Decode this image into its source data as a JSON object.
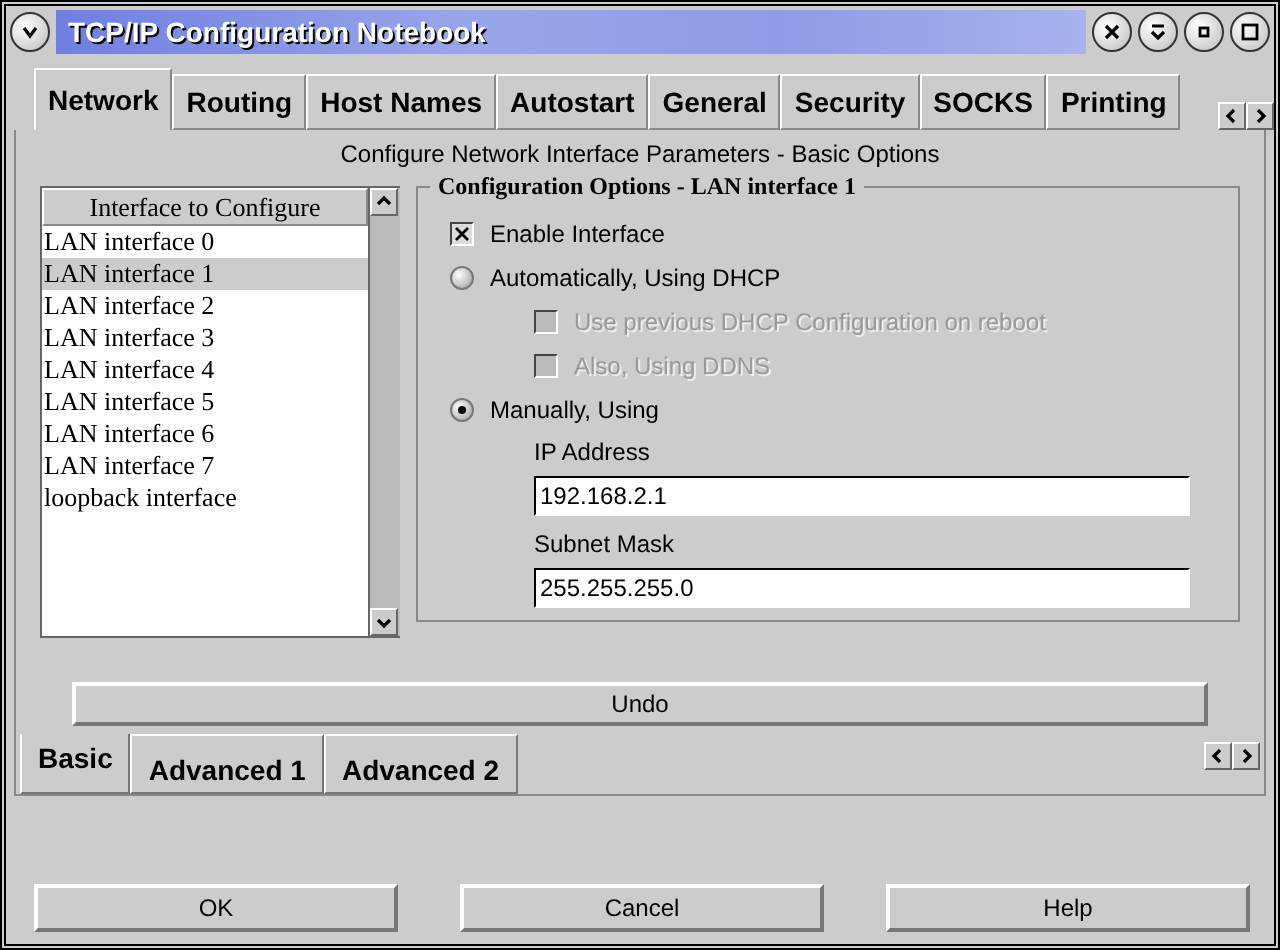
{
  "window": {
    "title": "TCP/IP Configuration Notebook"
  },
  "tabs": [
    {
      "label": "Network",
      "selected": true
    },
    {
      "label": "Routing",
      "selected": false
    },
    {
      "label": "Host Names",
      "selected": false
    },
    {
      "label": "Autostart",
      "selected": false
    },
    {
      "label": "General",
      "selected": false
    },
    {
      "label": "Security",
      "selected": false
    },
    {
      "label": "SOCKS",
      "selected": false
    },
    {
      "label": "Printing",
      "selected": false
    }
  ],
  "page_heading": "Configure Network Interface Parameters - Basic Options",
  "interface_list": {
    "header": "Interface to Configure",
    "items": [
      {
        "label": "LAN interface 0",
        "selected": false
      },
      {
        "label": "LAN interface 1",
        "selected": true
      },
      {
        "label": "LAN interface 2",
        "selected": false
      },
      {
        "label": "LAN interface 3",
        "selected": false
      },
      {
        "label": "LAN interface 4",
        "selected": false
      },
      {
        "label": "LAN interface 5",
        "selected": false
      },
      {
        "label": "LAN interface 6",
        "selected": false
      },
      {
        "label": "LAN interface 7",
        "selected": false
      },
      {
        "label": "loopback interface",
        "selected": false
      }
    ]
  },
  "group": {
    "title": "Configuration Options - LAN interface 1",
    "options": [
      {
        "kind": "checkbox",
        "label": "Enable Interface",
        "checked": true,
        "disabled": false
      },
      {
        "kind": "radio",
        "label": "Automatically, Using DHCP",
        "selected": false,
        "children": [
          {
            "kind": "checkbox",
            "label": "Use previous DHCP Configuration on reboot",
            "checked": false,
            "disabled": true
          },
          {
            "kind": "checkbox",
            "label": "Also, Using DDNS",
            "checked": false,
            "disabled": true
          }
        ]
      },
      {
        "kind": "radio",
        "label": "Manually, Using",
        "selected": true,
        "children": [
          {
            "kind": "field",
            "label": "IP Address",
            "value": "192.168.2.1"
          },
          {
            "kind": "field",
            "label": "Subnet Mask",
            "value": "255.255.255.0"
          }
        ]
      }
    ]
  },
  "undo_button": "Undo",
  "sub_tabs": [
    {
      "label": "Basic",
      "selected": true
    },
    {
      "label": "Advanced 1",
      "selected": false
    },
    {
      "label": "Advanced 2",
      "selected": false
    }
  ],
  "buttons": [
    "OK",
    "Cancel",
    "Help"
  ]
}
